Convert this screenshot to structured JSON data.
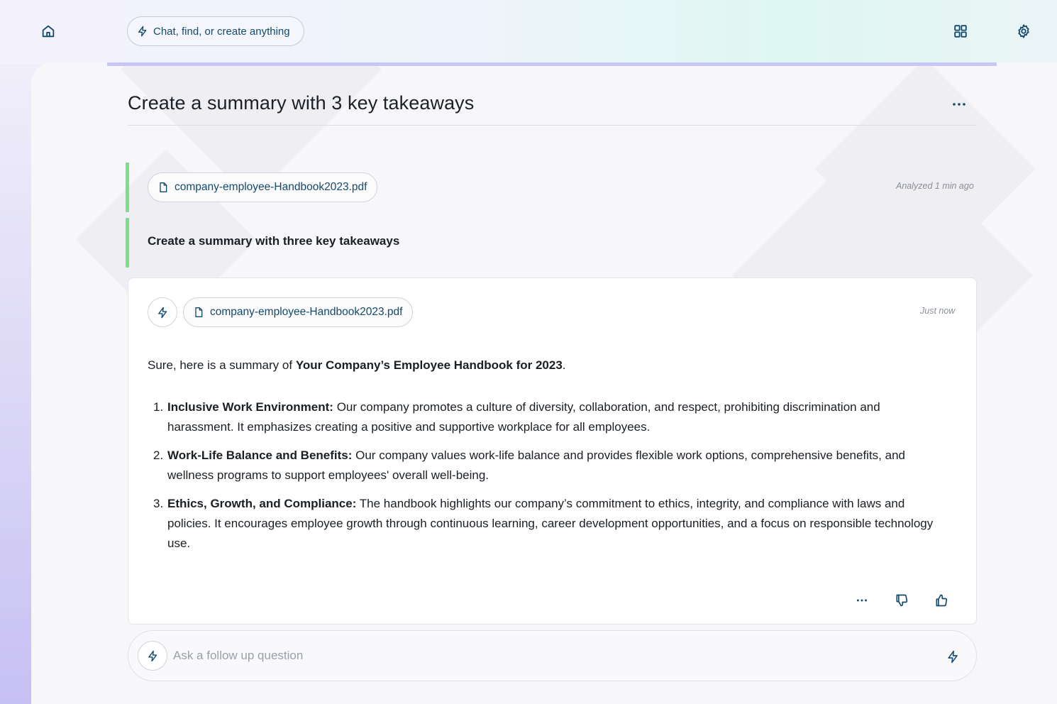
{
  "header": {
    "command_placeholder": "Chat, find, or create anything",
    "icons": {
      "home": "home-icon",
      "apps": "grid-icon",
      "settings": "gear-icon"
    }
  },
  "conversation": {
    "title": "Create a summary with 3 key takeaways",
    "user_message": {
      "file_name": "company-employee-Handbook2023.pdf",
      "timestamp": "Analyzed 1 min ago",
      "prompt": "Create a summary with three key takeaways"
    },
    "answer": {
      "file_name": "company-employee-Handbook2023.pdf",
      "timestamp": "Just now",
      "intro_prefix": "Sure, here is a summary of ",
      "intro_bold": "Your Company’s Employee Handbook for 2023",
      "intro_suffix": ".",
      "takeaways": [
        {
          "number": "1.",
          "heading": "Inclusive Work Environment:",
          "text": " Our company promotes a culture of diversity, collaboration, and respect, prohibiting discrimination and harassment. It emphasizes creating a positive and supportive workplace for all employees."
        },
        {
          "number": "2.",
          "heading": "Work-Life Balance and Benefits:",
          "text": " Our company values work-life balance and provides flexible work options, comprehensive benefits, and wellness programs to support employees' overall well-being."
        },
        {
          "number": "3.",
          "heading": "Ethics, Growth, and Compliance:",
          "text": " The handbook highlights our company’s commitment to ethics, integrity, and compliance with laws and policies. It encourages employee growth through continuous learning, career development opportunities, and a focus on responsible technology use."
        }
      ]
    }
  },
  "followup": {
    "placeholder": "Ask a follow up question"
  },
  "colors": {
    "accent": "#134a6e",
    "user_marker": "#7ce089",
    "progress": "#c8c6f4"
  }
}
